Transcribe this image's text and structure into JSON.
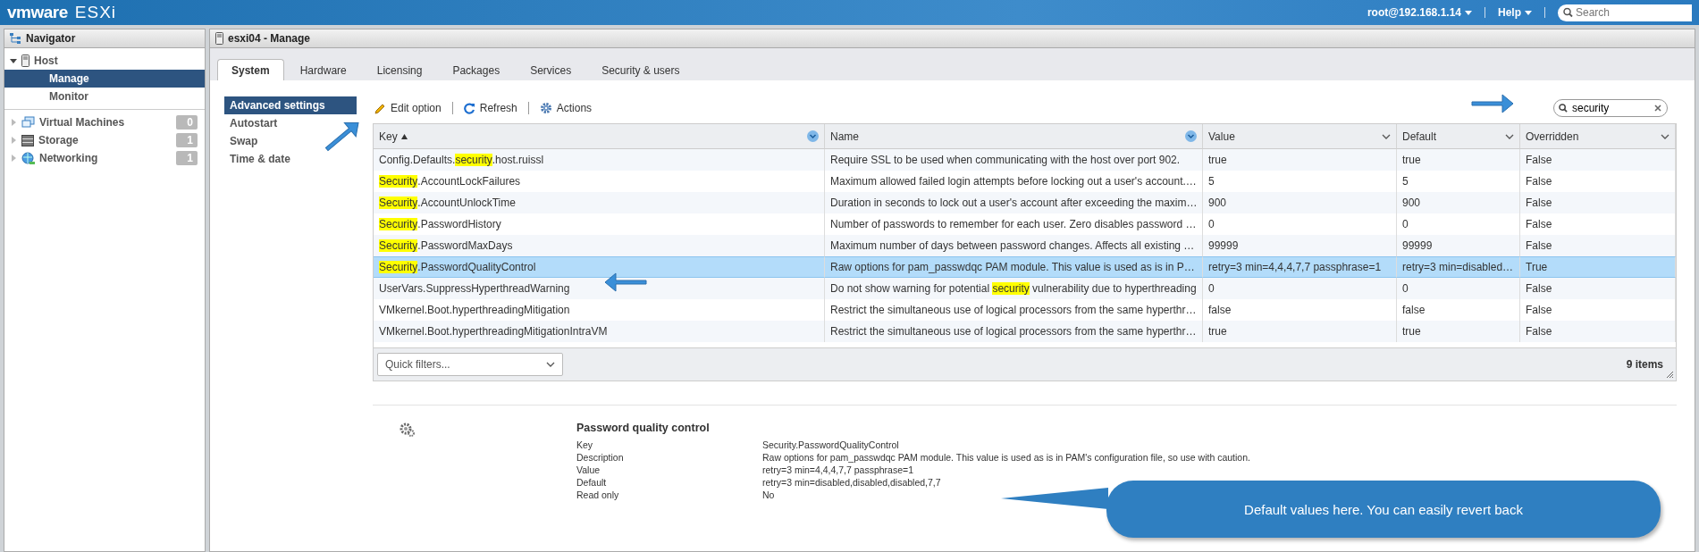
{
  "header": {
    "logo_brand": "vmware",
    "logo_product": "ESXi",
    "user": "root@192.168.1.14",
    "help": "Help",
    "search": {
      "placeholder": "Search"
    }
  },
  "navigator": {
    "title": "Navigator",
    "items": [
      {
        "label": "Host",
        "kind": "group",
        "expanded": true,
        "children": [
          {
            "label": "Manage",
            "selected": true
          },
          {
            "label": "Monitor",
            "selected": false
          }
        ]
      },
      {
        "label": "Virtual Machines",
        "kind": "vm",
        "expanded": false,
        "count": "0"
      },
      {
        "label": "Storage",
        "kind": "storage",
        "expanded": false,
        "count": "1"
      },
      {
        "label": "Networking",
        "kind": "network",
        "expanded": false,
        "count": "1"
      }
    ]
  },
  "panel": {
    "title": "esxi04 - Manage",
    "tabs": [
      {
        "label": "System",
        "selected": true
      },
      {
        "label": "Hardware",
        "selected": false
      },
      {
        "label": "Licensing",
        "selected": false
      },
      {
        "label": "Packages",
        "selected": false
      },
      {
        "label": "Services",
        "selected": false
      },
      {
        "label": "Security & users",
        "selected": false
      }
    ],
    "subnav": [
      {
        "label": "Advanced settings",
        "selected": true
      },
      {
        "label": "Autostart",
        "selected": false
      },
      {
        "label": "Swap",
        "selected": false
      },
      {
        "label": "Time & date",
        "selected": false
      }
    ],
    "toolbar": [
      {
        "label": "Edit option",
        "kind": "edit"
      },
      {
        "label": "Refresh",
        "kind": "refresh"
      },
      {
        "label": "Actions",
        "kind": "actions"
      }
    ],
    "filter": {
      "value": "security"
    },
    "table": {
      "columns": [
        {
          "label": "Key",
          "sorted": true,
          "filter_active": true
        },
        {
          "label": "Name",
          "sorted": false,
          "filter_active": true
        },
        {
          "label": "Value",
          "sorted": false,
          "filter_active": false
        },
        {
          "label": "Default",
          "sorted": false,
          "filter_active": false
        },
        {
          "label": "Overridden",
          "sorted": false,
          "filter_active": false
        }
      ],
      "rows": [
        {
          "selected": false,
          "key": [
            {
              "text": "Config.Defaults.",
              "highlight": false
            },
            {
              "text": "security",
              "highlight": true
            },
            {
              "text": ".host.ruissl",
              "highlight": false
            }
          ],
          "name": [
            {
              "text": "Require SSL to be used when communicating with the host over port 902.",
              "highlight": false
            }
          ],
          "value": "true",
          "default": "true",
          "overridden": "False"
        },
        {
          "selected": false,
          "key": [
            {
              "text": "Security",
              "highlight": true
            },
            {
              "text": ".AccountLockFailures",
              "highlight": false
            }
          ],
          "name": [
            {
              "text": "Maximum allowed failed login attempts before locking out a user's account.…",
              "highlight": false
            }
          ],
          "value": "5",
          "default": "5",
          "overridden": "False"
        },
        {
          "selected": false,
          "key": [
            {
              "text": "Security",
              "highlight": true
            },
            {
              "text": ".AccountUnlockTime",
              "highlight": false
            }
          ],
          "name": [
            {
              "text": "Duration in seconds to lock out a user's account after exceeding the maxim…",
              "highlight": false
            }
          ],
          "value": "900",
          "default": "900",
          "overridden": "False"
        },
        {
          "selected": false,
          "key": [
            {
              "text": "Security",
              "highlight": true
            },
            {
              "text": ".PasswordHistory",
              "highlight": false
            }
          ],
          "name": [
            {
              "text": "Number of passwords to remember for each user. Zero disables password …",
              "highlight": false
            }
          ],
          "value": "0",
          "default": "0",
          "overridden": "False"
        },
        {
          "selected": false,
          "key": [
            {
              "text": "Security",
              "highlight": true
            },
            {
              "text": ".PasswordMaxDays",
              "highlight": false
            }
          ],
          "name": [
            {
              "text": "Maximum number of days between password changes. Affects all existing …",
              "highlight": false
            }
          ],
          "value": "99999",
          "default": "99999",
          "overridden": "False"
        },
        {
          "selected": true,
          "key": [
            {
              "text": "Security",
              "highlight": true
            },
            {
              "text": ".PasswordQualityControl",
              "highlight": false
            }
          ],
          "name": [
            {
              "text": "Raw options for pam_passwdqc PAM module. This value is used as is in P…",
              "highlight": false
            }
          ],
          "value": "retry=3 min=4,4,4,7,7 passphrase=1",
          "default": "retry=3 min=disabled…",
          "overridden": "True"
        },
        {
          "selected": false,
          "key": [
            {
              "text": "UserVars.SuppressHyperthreadWarning",
              "highlight": false
            }
          ],
          "name": [
            {
              "text": "Do not show warning for potential ",
              "highlight": false
            },
            {
              "text": "security",
              "highlight": true
            },
            {
              "text": " vulnerability due to hyperthreading",
              "highlight": false
            }
          ],
          "value": "0",
          "default": "0",
          "overridden": "False"
        },
        {
          "selected": false,
          "key": [
            {
              "text": "VMkernel.Boot.hyperthreadingMitigation",
              "highlight": false
            }
          ],
          "name": [
            {
              "text": "Restrict the simultaneous use of logical processors from the same hyperthr…",
              "highlight": false
            }
          ],
          "value": "false",
          "default": "false",
          "overridden": "False"
        },
        {
          "selected": false,
          "key": [
            {
              "text": "VMkernel.Boot.hyperthreadingMitigationIntraVM",
              "highlight": false
            }
          ],
          "name": [
            {
              "text": "Restrict the simultaneous use of logical processors from the same hyperthr…",
              "highlight": false
            }
          ],
          "value": "true",
          "default": "true",
          "overridden": "False"
        }
      ],
      "quick_filters": {
        "placeholder": "Quick filters..."
      },
      "count": "9 items"
    },
    "detail": {
      "title": "Password quality control",
      "properties": [
        {
          "label": "Key",
          "value": "Security.PasswordQualityControl"
        },
        {
          "label": "Description",
          "value": "Raw options for pam_passwdqc PAM module. This value is used as is in PAM's configuration file, so use with caution."
        },
        {
          "label": "Value",
          "value": "retry=3 min=4,4,4,7,7 passphrase=1"
        },
        {
          "label": "Default",
          "value": "retry=3 min=disabled,disabled,disabled,7,7"
        },
        {
          "label": "Read only",
          "value": "No"
        }
      ]
    }
  },
  "callout": {
    "text": "Default values here. You can easily revert back"
  }
}
